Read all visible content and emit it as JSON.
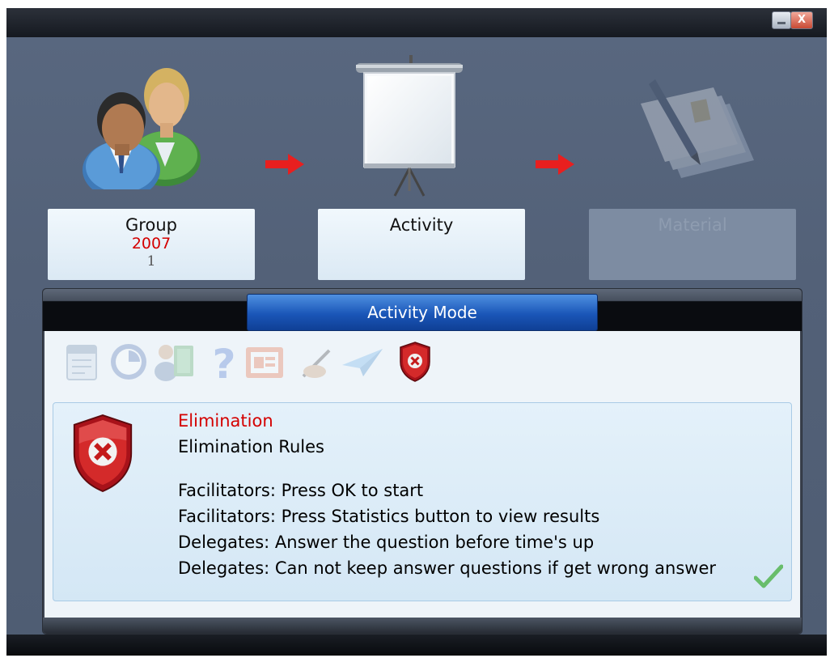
{
  "window": {
    "close_glyph": "X"
  },
  "steps": [
    {
      "title": "Group",
      "year": "2007",
      "sub": "1",
      "icon": "people-icon",
      "enabled": true
    },
    {
      "title": "Activity",
      "icon": "projector-screen-icon",
      "enabled": true
    },
    {
      "title": "Material",
      "icon": "documents-pen-icon",
      "enabled": false
    }
  ],
  "panel": {
    "tab_label": "Activity Mode"
  },
  "toolbar": [
    {
      "icon": "calendar-icon",
      "enabled": false
    },
    {
      "icon": "clock-chart-icon",
      "enabled": false
    },
    {
      "icon": "person-book-icon",
      "enabled": false
    },
    {
      "icon": "question-mark-icon",
      "enabled": false
    },
    {
      "icon": "presentation-icon",
      "enabled": false
    },
    {
      "icon": "hand-pen-icon",
      "enabled": false
    },
    {
      "icon": "paper-plane-icon",
      "enabled": false
    },
    {
      "icon": "elimination-shield-icon",
      "enabled": true
    }
  ],
  "rules": {
    "title": "Elimination",
    "subtitle": "Elimination Rules",
    "lines": [
      "Facilitators: Press OK to start",
      "Facilitators: Press Statistics button to view results",
      "Delegates: Answer the question before time's up",
      "Delegates: Can not keep answer questions if get wrong answer"
    ]
  },
  "colors": {
    "accent_red": "#d40000",
    "tab_blue": "#1a56b8",
    "background": "#536178"
  }
}
